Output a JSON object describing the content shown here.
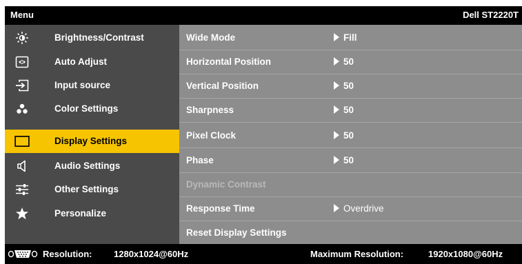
{
  "header": {
    "menu_title": "Menu",
    "model": "Dell ST2220T"
  },
  "sidebar": {
    "items": [
      {
        "label": "Brightness/Contrast",
        "icon": "brightness-icon",
        "active": false
      },
      {
        "label": "Auto Adjust",
        "icon": "auto-adjust-icon",
        "active": false
      },
      {
        "label": "Input source",
        "icon": "input-source-icon",
        "active": false
      },
      {
        "label": "Color Settings",
        "icon": "color-settings-icon",
        "active": false
      },
      {
        "label": "Display Settings",
        "icon": "display-icon",
        "active": true
      },
      {
        "label": "Audio Settings",
        "icon": "speaker-icon",
        "active": false
      },
      {
        "label": "Other Settings",
        "icon": "sliders-icon",
        "active": false
      },
      {
        "label": "Personalize",
        "icon": "star-icon",
        "active": false
      }
    ]
  },
  "settings": [
    {
      "name": "Wide Mode",
      "value": "Fill",
      "enabled": true
    },
    {
      "name": "Horizontal Position",
      "value": "50",
      "enabled": true
    },
    {
      "name": "Vertical Position",
      "value": "50",
      "enabled": true
    },
    {
      "name": "Sharpness",
      "value": "50",
      "enabled": true
    },
    {
      "name": "Pixel Clock",
      "value": "50",
      "enabled": true
    },
    {
      "name": "Phase",
      "value": "50",
      "enabled": true
    },
    {
      "name": "Dynamic Contrast",
      "value": "",
      "enabled": false
    },
    {
      "name": "Response Time",
      "value": "Overdrive",
      "enabled": true
    },
    {
      "name": "Reset Display Settings",
      "value": "",
      "enabled": true
    }
  ],
  "footer": {
    "resolution_label": "Resolution:",
    "resolution_value": "1280x1024@60Hz",
    "max_label": "Maximum Resolution:",
    "max_value": "1920x1080@60Hz",
    "connector_icon": "vga-connector-icon"
  },
  "colors": {
    "active_highlight": "#f6c400",
    "sidebar_bg": "#4a4a4a",
    "panel_bg": "#8d8d8d",
    "bar_bg": "#000000"
  }
}
